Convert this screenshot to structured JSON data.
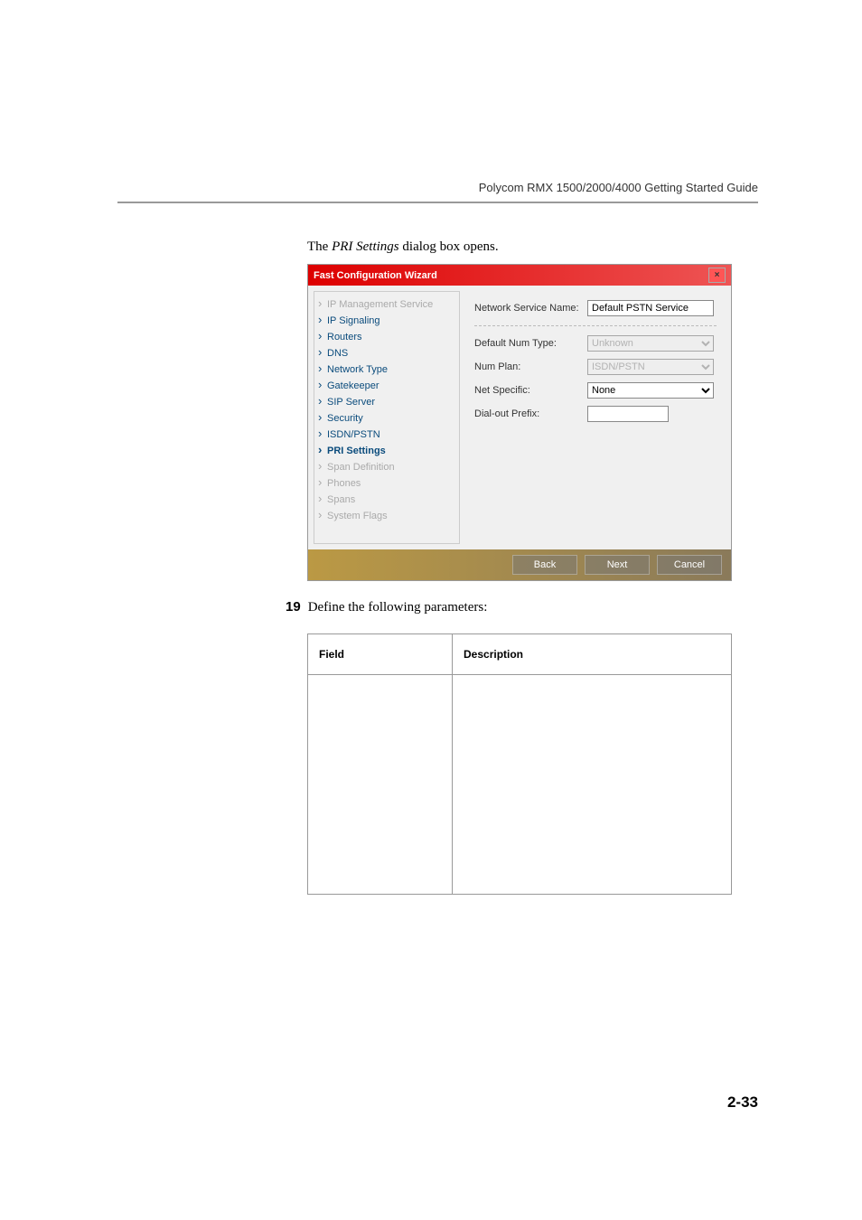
{
  "header": {
    "title": "Polycom RMX 1500/2000/4000 Getting Started Guide"
  },
  "intro_text_pre": "The ",
  "intro_text_em": "PRI Settings",
  "intro_text_post": " dialog box opens.",
  "dialog": {
    "title": "Fast Configuration Wizard",
    "close_icon": "×",
    "sidebar": {
      "items": [
        {
          "label": "IP Management Service",
          "state": "disabled"
        },
        {
          "label": "IP Signaling",
          "state": "normal"
        },
        {
          "label": "Routers",
          "state": "normal"
        },
        {
          "label": "DNS",
          "state": "normal"
        },
        {
          "label": "Network Type",
          "state": "normal"
        },
        {
          "label": "Gatekeeper",
          "state": "normal"
        },
        {
          "label": "SIP Server",
          "state": "normal"
        },
        {
          "label": "Security",
          "state": "normal"
        },
        {
          "label": "ISDN/PSTN",
          "state": "normal"
        },
        {
          "label": "PRI Settings",
          "state": "active"
        },
        {
          "label": "Span Definition",
          "state": "disabled"
        },
        {
          "label": "Phones",
          "state": "disabled"
        },
        {
          "label": "Spans",
          "state": "disabled"
        },
        {
          "label": "System Flags",
          "state": "disabled"
        }
      ]
    },
    "fields": {
      "service_name_label": "Network Service Name:",
      "service_name_value": "Default PSTN Service",
      "default_num_type_label": "Default Num Type:",
      "default_num_type_value": "Unknown",
      "num_plan_label": "Num Plan:",
      "num_plan_value": "ISDN/PSTN",
      "net_specific_label": "Net Specific:",
      "net_specific_value": "None",
      "dial_out_prefix_label": "Dial-out Prefix:",
      "dial_out_prefix_value": ""
    },
    "buttons": {
      "back": "Back",
      "next": "Next",
      "cancel": "Cancel"
    }
  },
  "step": {
    "number": "19",
    "text": "Define the following parameters:"
  },
  "table": {
    "headers": {
      "field": "Field",
      "description": "Description"
    }
  },
  "page_number": "2-33"
}
